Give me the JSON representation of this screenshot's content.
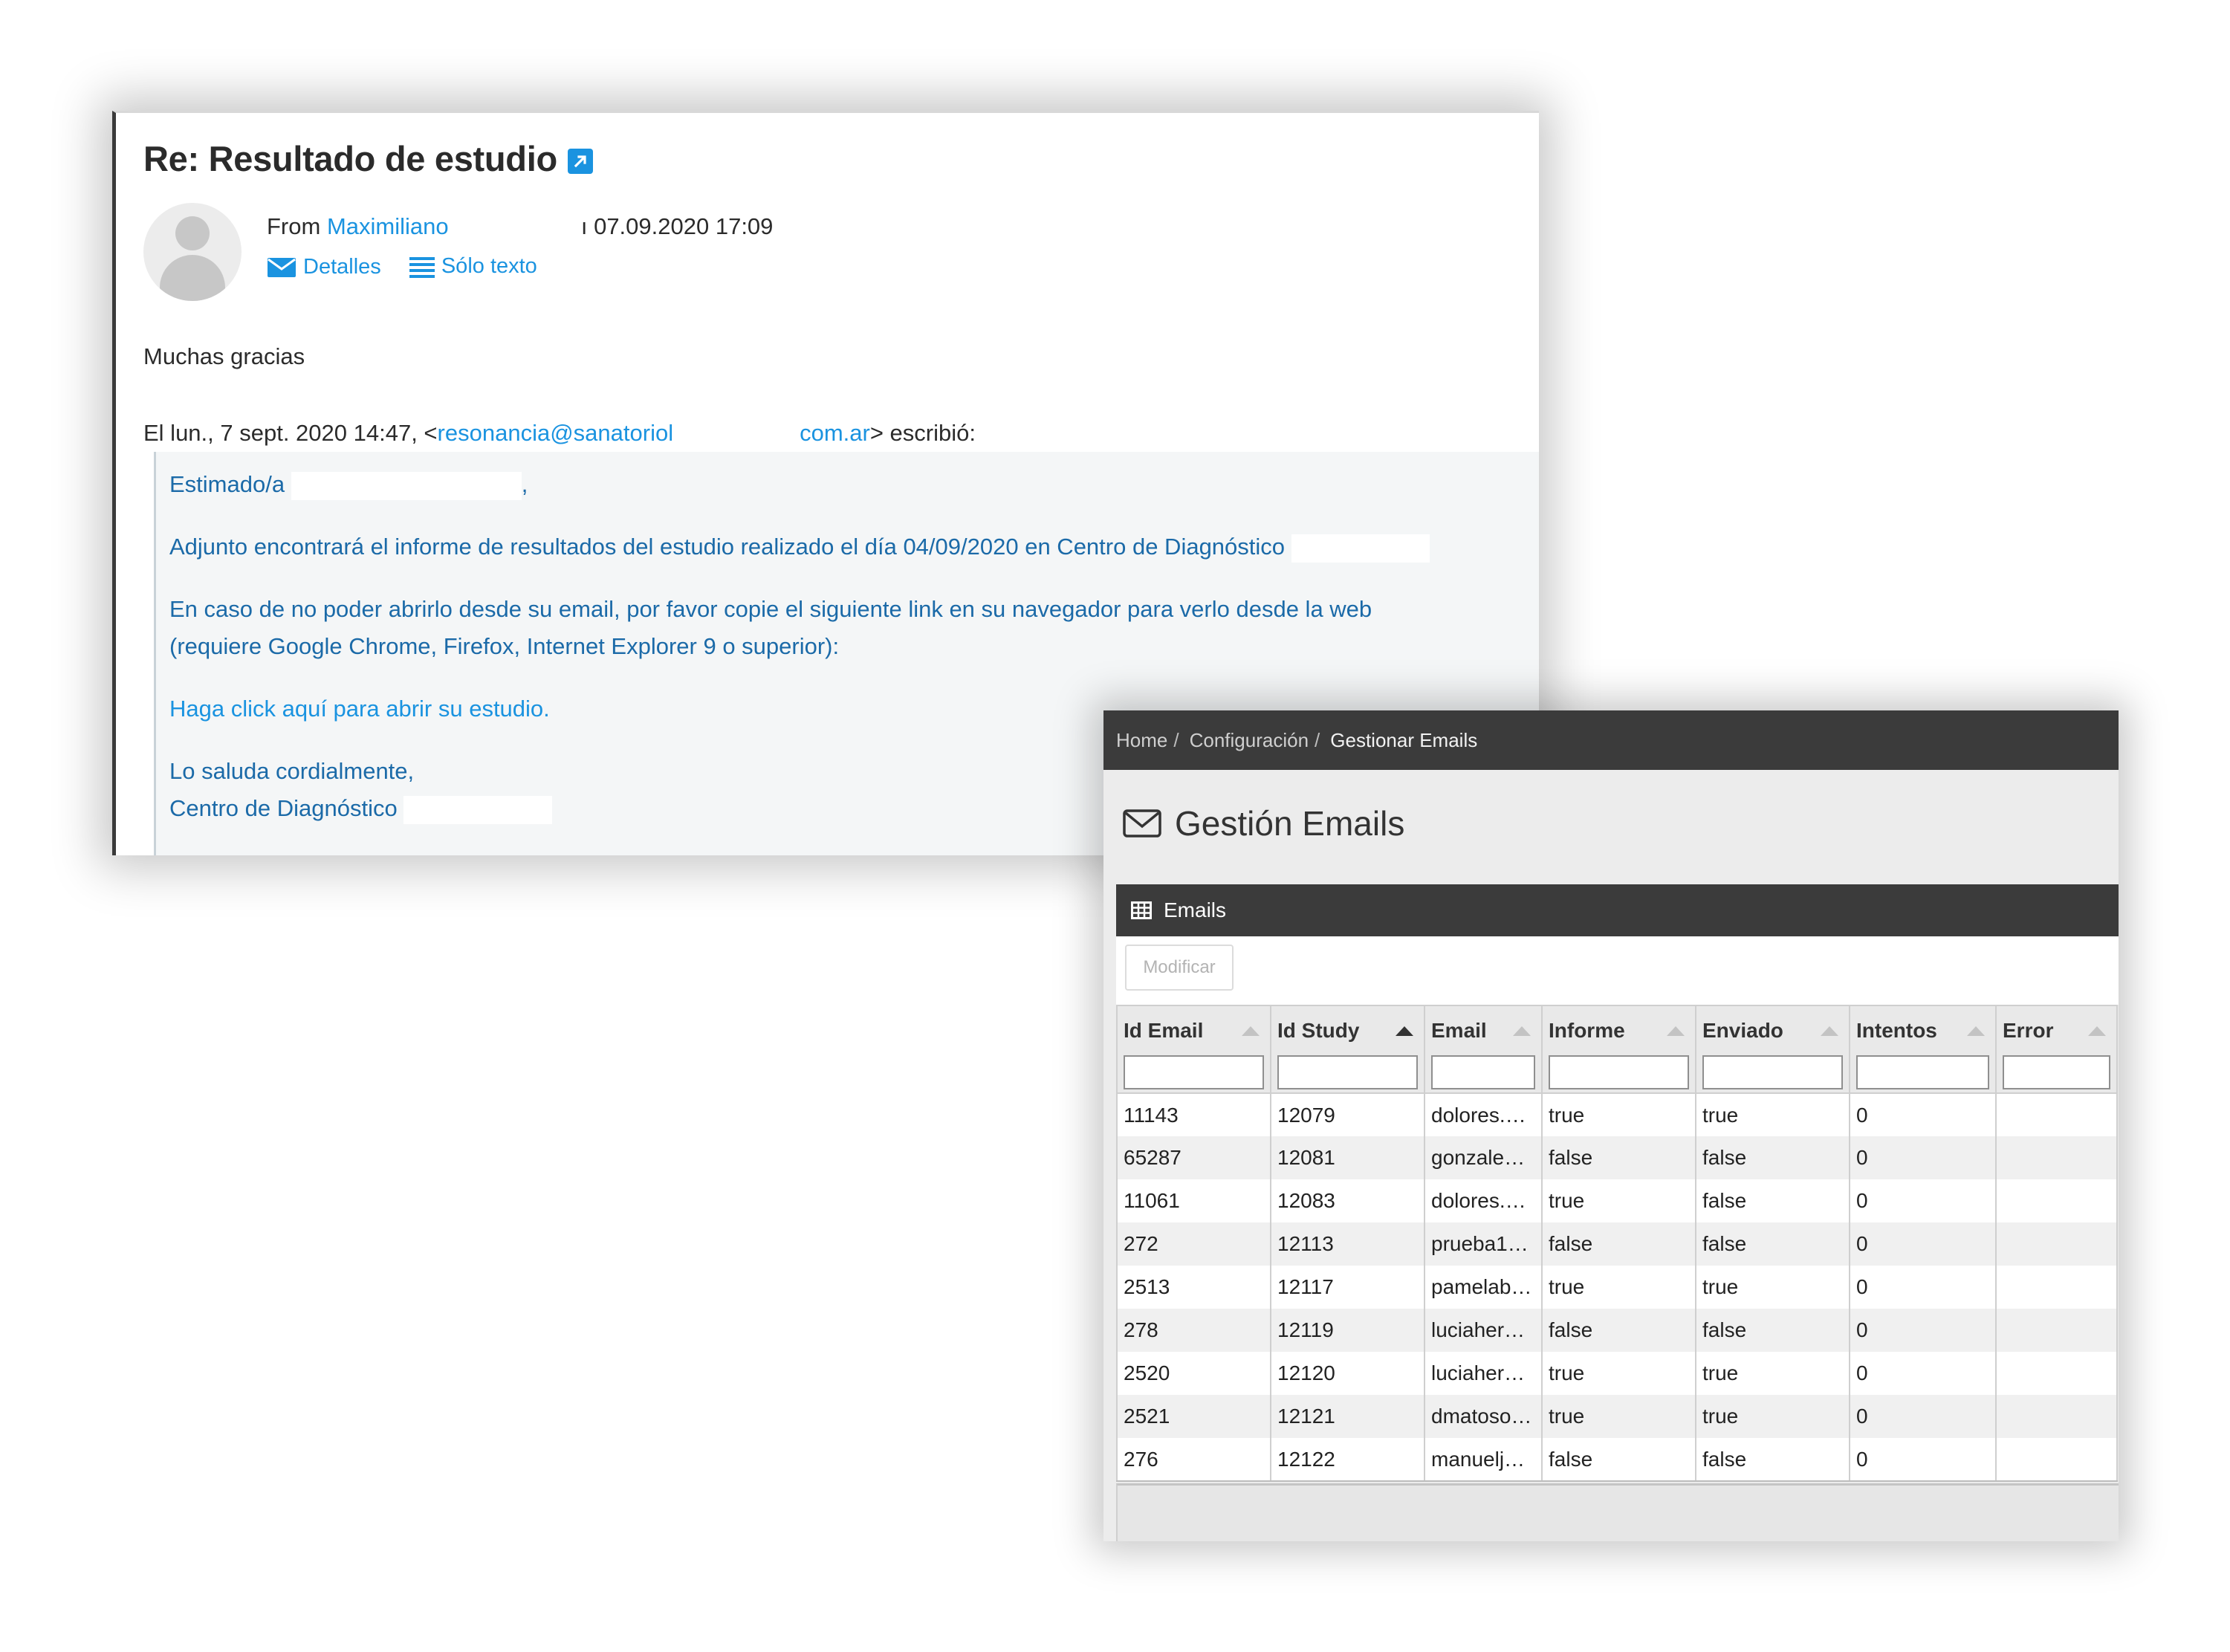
{
  "email": {
    "subject": "Re: Resultado de estudio",
    "from_prefix": "From",
    "from_name": "Maximiliano",
    "date": "07.09.2020 17:09",
    "details_label": "Detalles",
    "plain_text_label": "Sólo texto",
    "reply_text": "Muchas gracias",
    "quote_header_prefix": "El lun., 7 sept. 2020 14:47, <",
    "quote_email_part1": "resonancia@sanatoriol",
    "quote_email_part2": "com.ar",
    "quote_header_suffix": "> escribió:",
    "quoted": {
      "greeting": "Estimado/a",
      "greeting_suffix": ",",
      "line1": "Adjunto encontrará el informe de resultados del estudio realizado el día 04/09/2020 en Centro de Diagnóstico",
      "line2": "En caso de no poder abrirlo desde su email, por favor copie el siguiente link en su navegador para verlo desde la web",
      "line3": "(requiere Google Chrome, Firefox, Internet Explorer 9 o superior):",
      "link": "Haga click aquí para abrir su estudio.",
      "closing": "Lo saluda cordialmente,",
      "signature": "Centro de Diagnóstico"
    }
  },
  "admin": {
    "breadcrumb": [
      "Home",
      "Configuración",
      "Gestionar Emails"
    ],
    "breadcrumb_sep": "/",
    "page_title": "Gestión Emails",
    "panel_title": "Emails",
    "modify_button": "Modificar",
    "columns": [
      "Id Email",
      "Id Study",
      "Email",
      "Informe",
      "Enviado",
      "Intentos",
      "Error"
    ],
    "sorted_column": "Id Study",
    "rows": [
      [
        "11143",
        "12079",
        "dolores.…",
        "true",
        "true",
        "0",
        ""
      ],
      [
        "65287",
        "12081",
        "gonzale…",
        "false",
        "false",
        "0",
        ""
      ],
      [
        "11061",
        "12083",
        "dolores.…",
        "true",
        "false",
        "0",
        ""
      ],
      [
        "272",
        "12113",
        "prueba1…",
        "false",
        "false",
        "0",
        ""
      ],
      [
        "2513",
        "12117",
        "pamelab…",
        "true",
        "true",
        "0",
        ""
      ],
      [
        "278",
        "12119",
        "luciaher…",
        "false",
        "false",
        "0",
        ""
      ],
      [
        "2520",
        "12120",
        "luciaher…",
        "true",
        "true",
        "0",
        ""
      ],
      [
        "2521",
        "12121",
        "dmatoso…",
        "true",
        "true",
        "0",
        ""
      ],
      [
        "276",
        "12122",
        "manuelj…",
        "false",
        "false",
        "0",
        ""
      ]
    ]
  },
  "colors": {
    "link_blue": "#1a93e0",
    "quote_text": "#1b6aa8",
    "dark_header": "#3b3b3b"
  }
}
